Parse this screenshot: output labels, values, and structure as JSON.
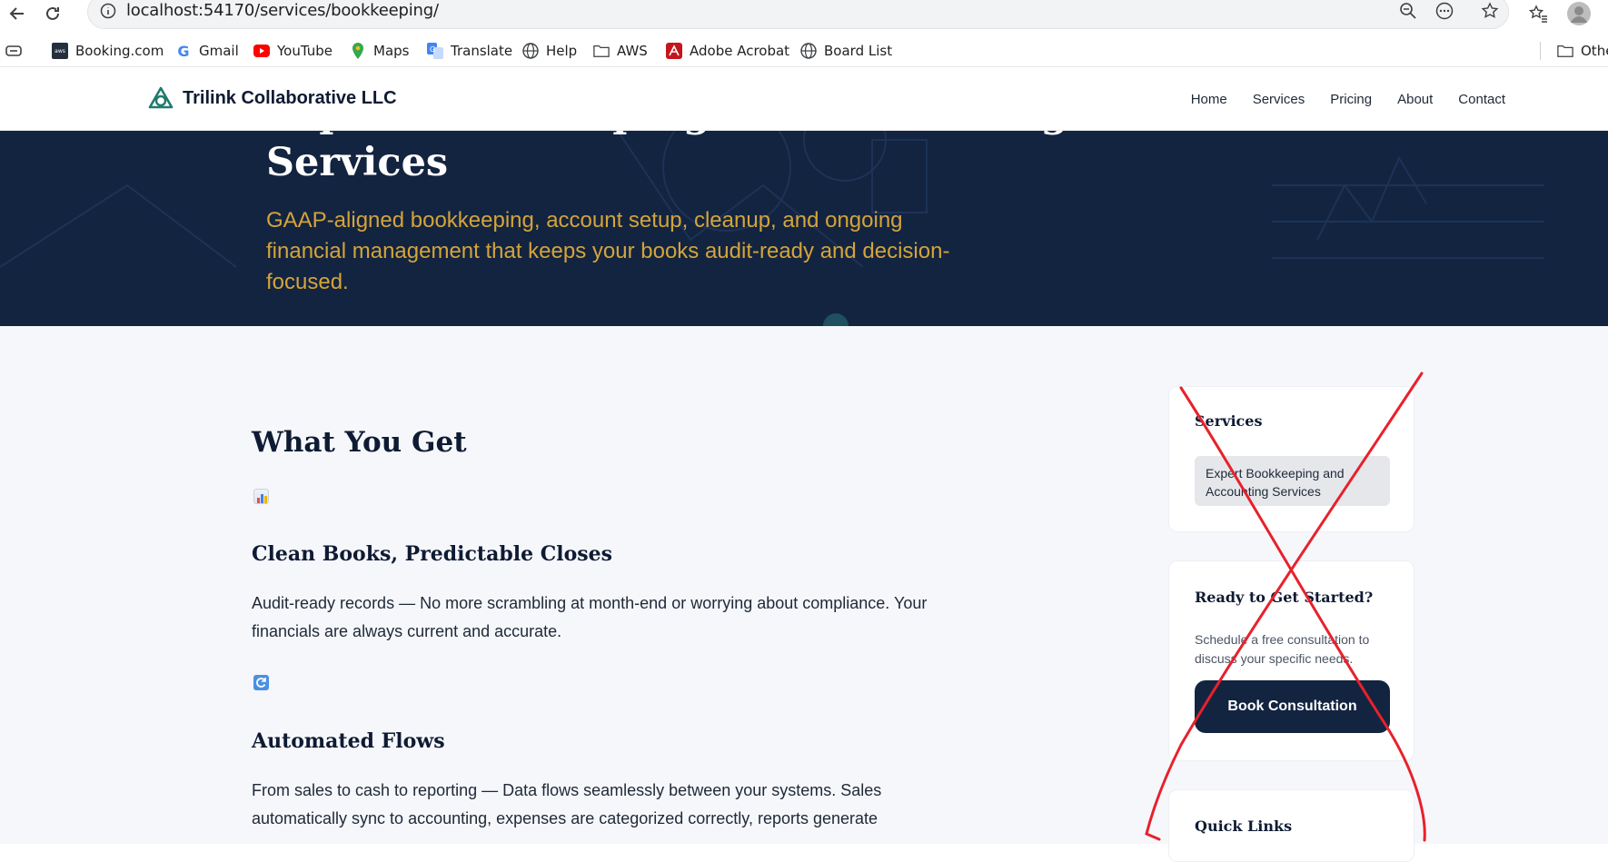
{
  "browser": {
    "url": "localhost:54170/services/bookkeeping/",
    "bookmarks": [
      {
        "label": "Booking.com",
        "icon": "aws-icon"
      },
      {
        "label": "Gmail",
        "icon": "google-icon"
      },
      {
        "label": "YouTube",
        "icon": "youtube-icon"
      },
      {
        "label": "Maps",
        "icon": "maps-pin-icon"
      },
      {
        "label": "Translate",
        "icon": "translate-icon"
      },
      {
        "label": "Help",
        "icon": "globe-icon"
      },
      {
        "label": "AWS",
        "icon": "folder-icon"
      },
      {
        "label": "Adobe Acrobat",
        "icon": "acrobat-icon"
      },
      {
        "label": "Board List",
        "icon": "globe-icon"
      }
    ],
    "other_bookmarks": "Othe"
  },
  "site": {
    "brand": "Trilink Collaborative LLC",
    "nav": [
      "Home",
      "Services",
      "Pricing",
      "About",
      "Contact"
    ]
  },
  "hero": {
    "title_line2": "Services",
    "subtitle": "GAAP-aligned bookkeeping, account setup, cleanup, and ongoing financial management that keeps your books audit-ready and decision-focused."
  },
  "content": {
    "section_title": "What You Get",
    "items": [
      {
        "emoji": "bar-chart-emoji",
        "title": "Clean Books, Predictable Closes",
        "text": "Audit-ready records — No more scrambling at month-end or worrying about compliance. Your financials are always current and accurate."
      },
      {
        "emoji": "refresh-emoji",
        "title": "Automated Flows",
        "text": "From sales to cash to reporting — Data flows seamlessly between your systems. Sales automatically sync to accounting, expenses are categorized correctly, reports generate"
      }
    ]
  },
  "sidebar": {
    "services_title": "Services",
    "services_link": "Expert Bookkeeping and Accounting Services",
    "cta_title": "Ready to Get Started?",
    "cta_text": "Schedule a free consultation to discuss your specific needs.",
    "cta_button": "Book Consultation",
    "quick_links_title": "Quick Links"
  },
  "colors": {
    "navy": "#132440",
    "gold": "#d4a43a",
    "annotation_red": "#e8212b"
  }
}
